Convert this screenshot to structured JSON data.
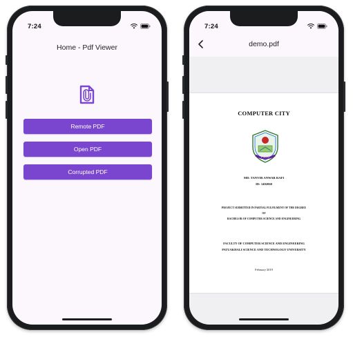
{
  "left_phone": {
    "status": {
      "time": "7:24"
    },
    "appbar": {
      "title": "Home - Pdf Viewer"
    },
    "icon": "pdf-file-icon",
    "buttons": {
      "remote": "Remote PDF",
      "open": "Open PDF",
      "corrupted": "Corrupted PDF"
    },
    "colors": {
      "accent": "#7a46cf",
      "background": "#fcf6fd"
    }
  },
  "right_phone": {
    "status": {
      "time": "7:24"
    },
    "appbar": {
      "title": "demo.pdf"
    },
    "document": {
      "title": "COMPUTER CITY",
      "seal_text": "P S T U",
      "name": "MD. TANVIR ANWAR RAFI",
      "id": "ID: 1402060",
      "purpose_line1": "PROJECT SUBMITTED IN PARTIAL FULFILMENT OF THE DEGREE",
      "purpose_line2": "OF",
      "purpose_line3": "BACHELOR OF COMPUTER SCIENCE AND ENGINEERING",
      "faculty_line1": "FACULTY OF COMPUTER SCIENCE AND ENGINEERING",
      "faculty_line2": "PATUAKHALI SCIENCE AND TECHNOLOGY UNIVERSITY",
      "date": "February 2019"
    }
  }
}
